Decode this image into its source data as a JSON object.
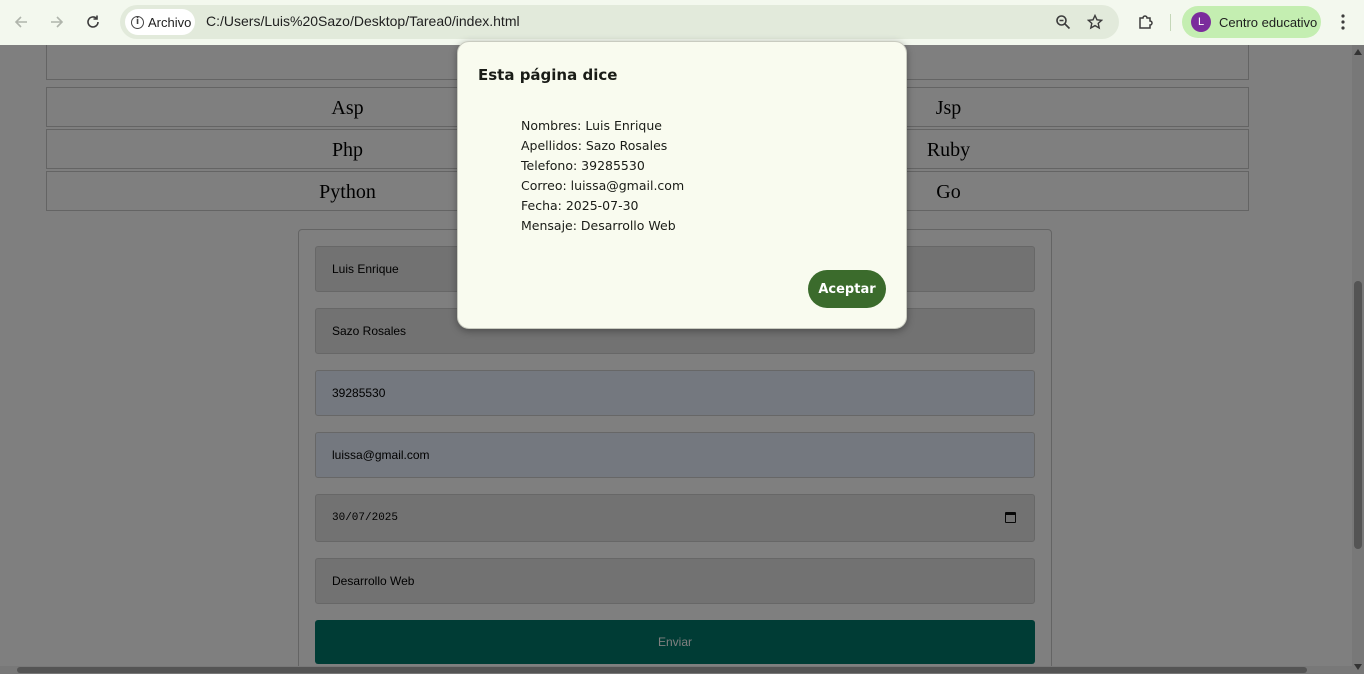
{
  "browser": {
    "site_chip_label": "Archivo",
    "url": "C:/Users/Luis%20Sazo/Desktop/Tarea0/index.html",
    "profile_initial": "L",
    "profile_label": "Centro educativo"
  },
  "languages": [
    [
      "Asp",
      "Jsp"
    ],
    [
      "Php",
      "Ruby"
    ],
    [
      "Python",
      "Go"
    ]
  ],
  "form": {
    "nombres": "Luis Enrique",
    "apellidos": "Sazo Rosales",
    "telefono": "39285530",
    "correo": "luissa@gmail.com",
    "fecha": "30/07/2025",
    "mensaje": "Desarrollo Web",
    "submit_label": "Enviar"
  },
  "dialog": {
    "title": "Esta página dice",
    "lines": [
      "Nombres: Luis Enrique",
      "Apellidos: Sazo Rosales",
      "Telefono: 39285530",
      "Correo: luissa@gmail.com",
      "Fecha: 2025-07-30",
      "Mensaje: Desarrollo Web"
    ],
    "accept_label": "Aceptar"
  },
  "colors": {
    "submit_button": "#00796b",
    "accept_button": "#3b6b2c",
    "avatar": "#7b2c9c"
  }
}
